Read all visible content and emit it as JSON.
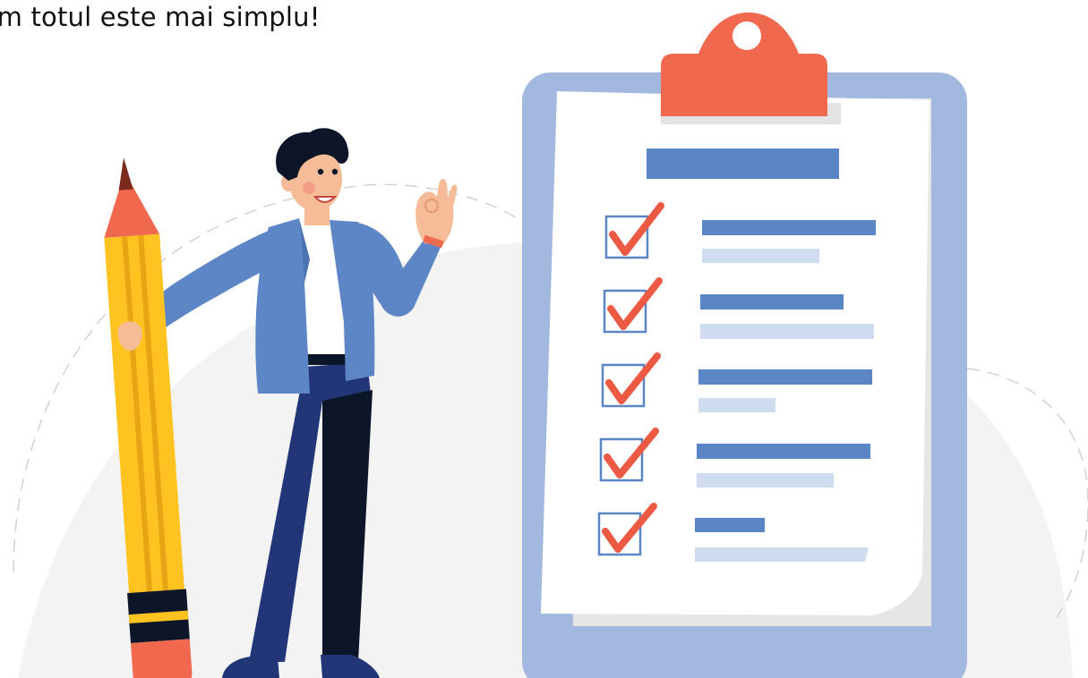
{
  "caption": {
    "text": "um totul este mai simplu!"
  },
  "illustration": {
    "icons": [
      "person-figure",
      "pencil-icon",
      "clipboard-icon",
      "checkbox-checked-icon"
    ],
    "checklist_items": [
      {
        "checked": true
      },
      {
        "checked": true
      },
      {
        "checked": true
      },
      {
        "checked": true
      },
      {
        "checked": true
      }
    ],
    "colors": {
      "blob": "#f3f3f3",
      "clipboard_board": "#a3b8df",
      "clip": "#f0694f",
      "paper": "#ffffff",
      "bar_dark": "#5b86c6",
      "bar_light": "#d0dcef",
      "check": "#ec5a44",
      "pencil_body": "#fec320",
      "jacket": "#5c86c6",
      "pants": "#223677",
      "hair": "#0d1529",
      "skin": "#f6bc98"
    }
  }
}
